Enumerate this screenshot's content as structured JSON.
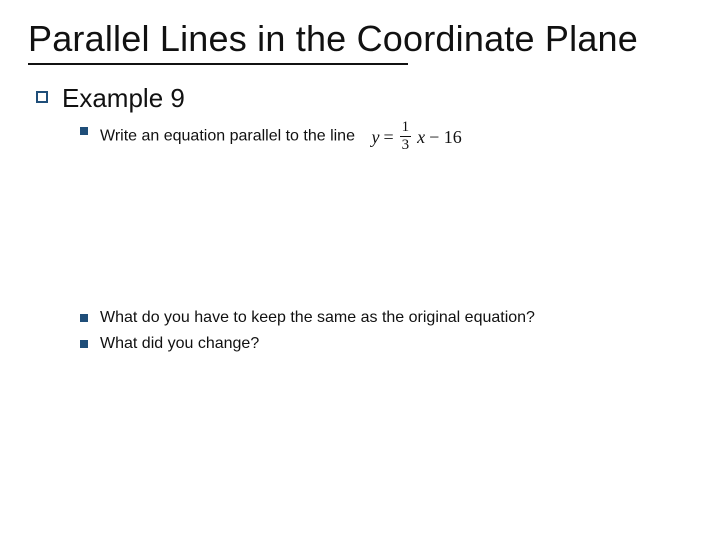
{
  "title": "Parallel Lines in the Coordinate Plane",
  "example_label": "Example 9",
  "bullets": {
    "write": "Write an equation parallel to the line",
    "keep_same": "What do you have to keep the same as the original equation?",
    "change": "What did you change?"
  },
  "equation": {
    "lhs": "y",
    "eq": "=",
    "frac_num": "1",
    "frac_den": "3",
    "var": "x",
    "tail": "− 16"
  }
}
